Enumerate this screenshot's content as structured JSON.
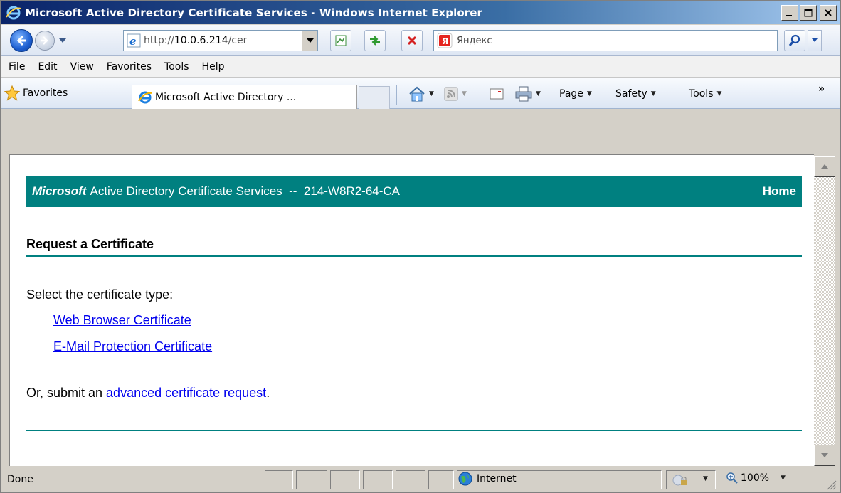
{
  "window": {
    "title": "Microsoft Active Directory Certificate Services - Windows Internet Explorer"
  },
  "address_bar": {
    "url_prefix": "http://",
    "url_host": "10.0.6.214",
    "url_rest": "/cer",
    "search_placeholder": "Яндекс"
  },
  "menu": {
    "items": [
      "File",
      "Edit",
      "View",
      "Favorites",
      "Tools",
      "Help"
    ]
  },
  "command_bar": {
    "favorites_label": "Favorites",
    "tab_title": "Microsoft Active Directory ...",
    "page_label": "Page",
    "safety_label": "Safety",
    "tools_label": "Tools",
    "more_label": "»"
  },
  "page": {
    "header_brand": "Microsoft",
    "header_text": "Active Directory Certificate Services  --  214-W8R2-64-CA",
    "home_link": "Home",
    "title": "Request a Certificate",
    "select_prompt": "Select the certificate type:",
    "cert_types": [
      "Web Browser Certificate",
      "E-Mail Protection Certificate"
    ],
    "advanced_prefix": "Or, submit an ",
    "advanced_link": "advanced certificate request",
    "advanced_suffix": "."
  },
  "status_bar": {
    "status": "Done",
    "zone": "Internet",
    "zoom": "100%"
  },
  "colors": {
    "header_teal": "#008080",
    "link_blue": "#0000ee"
  }
}
